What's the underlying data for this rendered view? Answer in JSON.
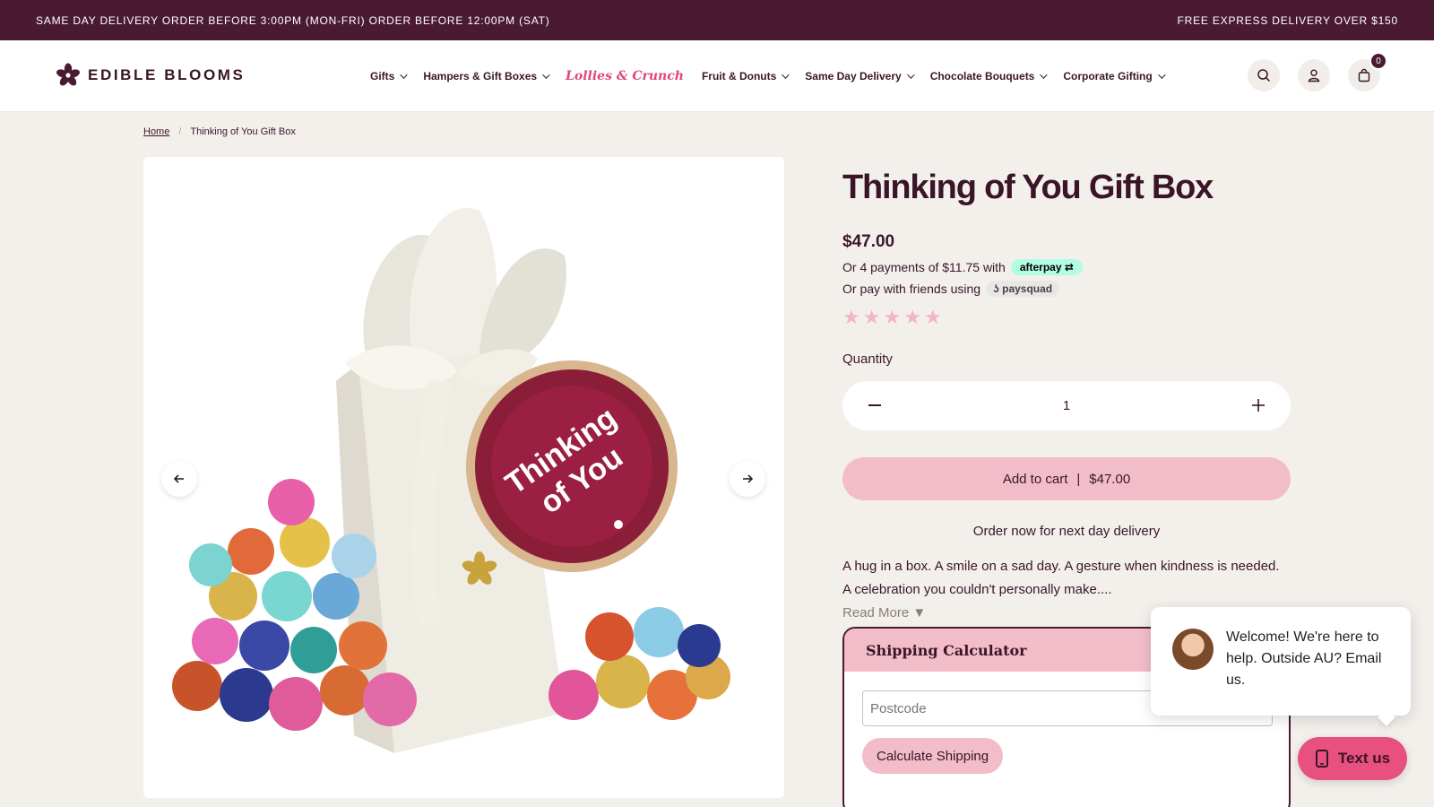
{
  "announcement": {
    "left": "SAME DAY DELIVERY ORDER BEFORE 3:00PM (MON-FRI) ORDER BEFORE 12:00PM (SAT)",
    "right": "FREE EXPRESS DELIVERY OVER $150"
  },
  "header": {
    "logo_text": "EDIBLE BLOOMS",
    "nav": [
      {
        "label": "Gifts"
      },
      {
        "label": "Hampers & Gift Boxes"
      },
      {
        "label": "Lollies & Crunch"
      },
      {
        "label": "Fruit & Donuts"
      },
      {
        "label": "Same Day Delivery"
      },
      {
        "label": "Chocolate Bouquets"
      },
      {
        "label": "Corporate Gifting"
      }
    ],
    "cart_count": "0"
  },
  "breadcrumb": {
    "home": "Home",
    "current": "Thinking of You Gift Box"
  },
  "product": {
    "title": "Thinking of You Gift Box",
    "price": "$47.00",
    "afterpay_text": "Or 4 payments of $11.75 with",
    "afterpay_brand": "afterpay",
    "paysquad_text": "Or pay with friends using",
    "paysquad_brand": "paysquad",
    "rating_stars": 5,
    "quantity_label": "Quantity",
    "quantity": "1",
    "add_to_cart_label": "Add to cart",
    "add_to_cart_sep": "|",
    "add_to_cart_price": "$47.00",
    "order_now": "Order now for next day delivery",
    "description": "A hug in a box. A smile on a sad day. A gesture when kindness is needed. A celebration you couldn't personally make....",
    "read_more": "Read More ▼",
    "image_tag_line1": "Thinking",
    "image_tag_line2": "of You"
  },
  "shipping": {
    "title": "Shipping Calculator",
    "postcode_placeholder": "Postcode",
    "button": "Calculate Shipping"
  },
  "chat": {
    "message": "Welcome! We're here to help. Outside AU? Email us.",
    "button": "Text us"
  },
  "colors": {
    "brand_dark": "#4a1a32",
    "pink": "#f2bdc9",
    "accent_pink": "#e8507f",
    "background": "#f3f0ec"
  }
}
